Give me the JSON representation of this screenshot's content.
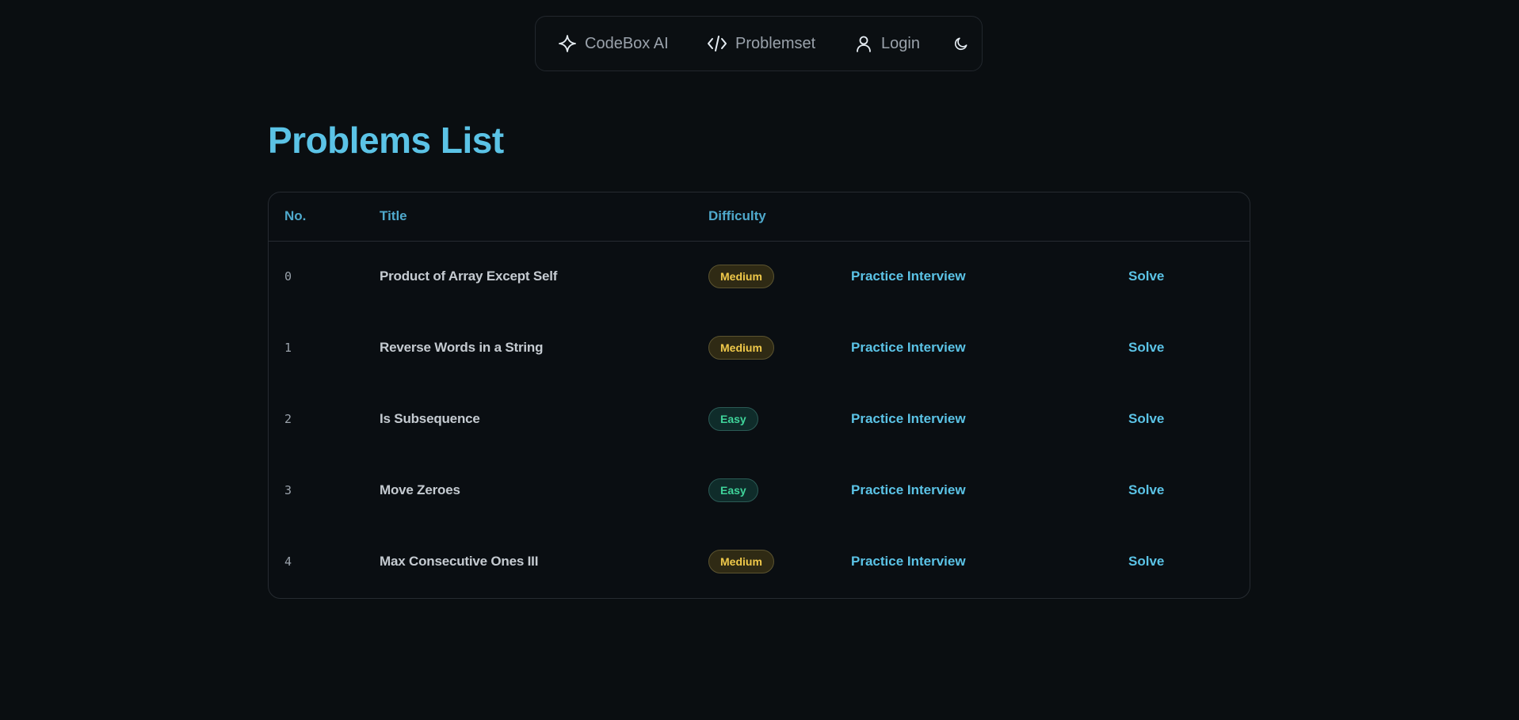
{
  "nav": {
    "items": [
      {
        "label": "CodeBox AI",
        "icon": "sparkle-icon"
      },
      {
        "label": "Problemset",
        "icon": "code-icon"
      },
      {
        "label": "Login",
        "icon": "user-icon"
      }
    ],
    "theme_icon": "moon-icon"
  },
  "page": {
    "title": "Problems List"
  },
  "table": {
    "headers": [
      "No.",
      "Title",
      "Difficulty"
    ],
    "rows": [
      {
        "no": "0",
        "title": "Product of Array Except Self",
        "difficulty": "Medium",
        "practice": "Practice Interview",
        "solve": "Solve"
      },
      {
        "no": "1",
        "title": "Reverse Words in a String",
        "difficulty": "Medium",
        "practice": "Practice Interview",
        "solve": "Solve"
      },
      {
        "no": "2",
        "title": "Is Subsequence",
        "difficulty": "Easy",
        "practice": "Practice Interview",
        "solve": "Solve"
      },
      {
        "no": "3",
        "title": "Move Zeroes",
        "difficulty": "Easy",
        "practice": "Practice Interview",
        "solve": "Solve"
      },
      {
        "no": "4",
        "title": "Max Consecutive Ones III",
        "difficulty": "Medium",
        "practice": "Practice Interview",
        "solve": "Solve"
      }
    ]
  },
  "colors": {
    "background": "#0a0e11",
    "accent": "#5bc3e6",
    "medium": "#f0c94a",
    "easy": "#3fd49a"
  }
}
